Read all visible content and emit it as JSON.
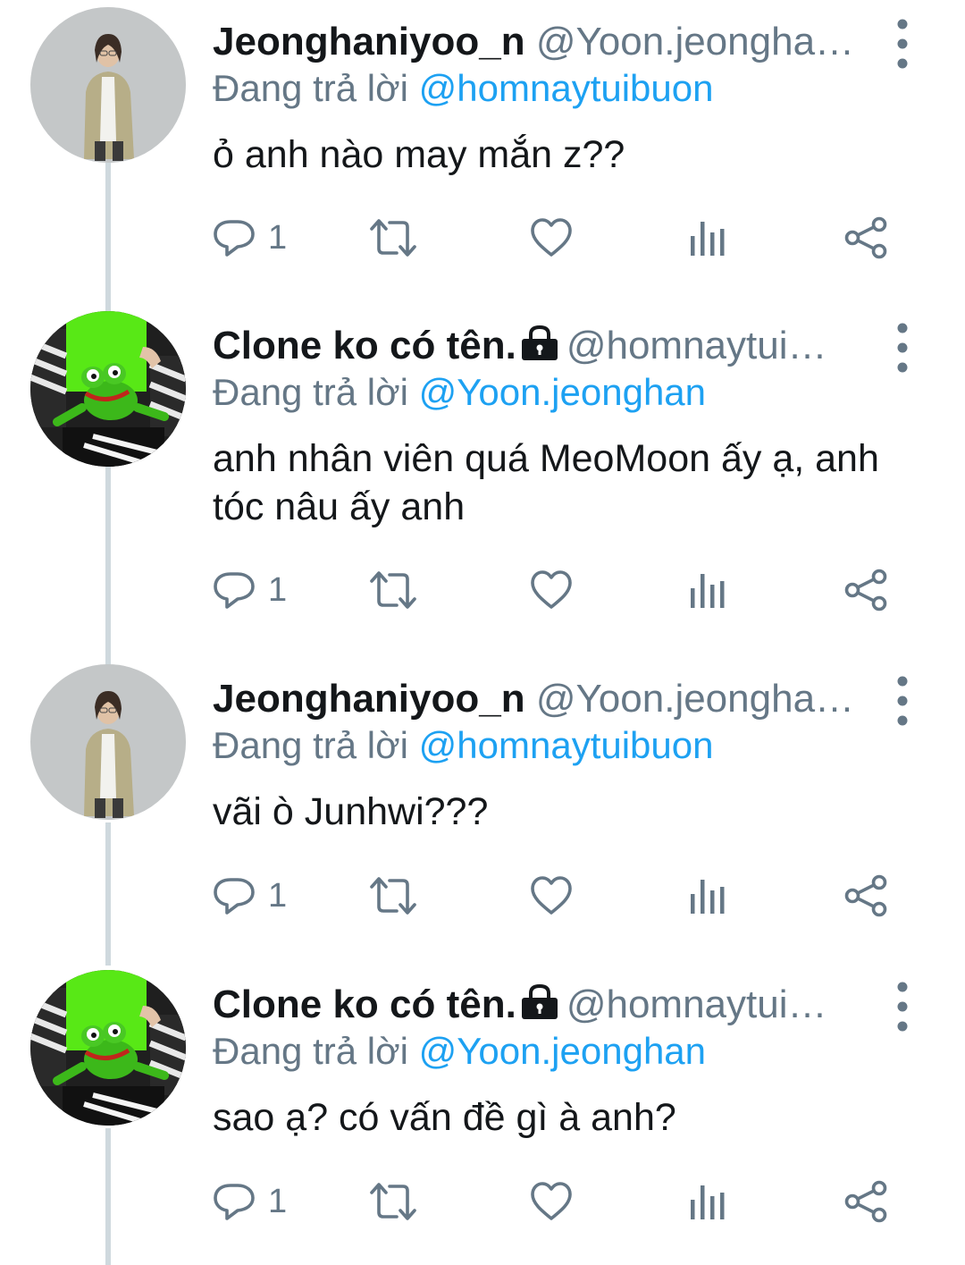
{
  "colors": {
    "accent": "#1da1f2",
    "secondary_text": "#657786",
    "thread_line": "#cfd9de"
  },
  "icons": {
    "more": "more-vertical-icon",
    "reply": "reply-icon",
    "retweet": "retweet-icon",
    "like": "heart-icon",
    "stats": "analytics-icon",
    "share": "share-icon",
    "lock": "lock-icon"
  },
  "tweets": [
    {
      "name": "Jeonghaniyoo_n",
      "handle": "@Yoon.jeongha…",
      "replying_prefix": "Đang trả lời ",
      "replying_to": "@homnaytuibuon",
      "text": "ỏ anh nào may mắn z??",
      "reply_count": "1"
    },
    {
      "name": "Clone ko có tên.",
      "handle": "@homnaytui…",
      "replying_prefix": "Đang trả lời ",
      "replying_to": "@Yoon.jeonghan",
      "text": "anh nhân viên quá MeoMoon ấy ạ, anh tóc nâu ấy anh",
      "reply_count": "1"
    },
    {
      "name": "Jeonghaniyoo_n",
      "handle": "@Yoon.jeongha…",
      "replying_prefix": "Đang trả lời ",
      "replying_to": "@homnaytuibuon",
      "text": "vãi ò Junhwi???",
      "reply_count": "1"
    },
    {
      "name": "Clone ko có tên.",
      "handle": "@homnaytui…",
      "replying_prefix": "Đang trả lời ",
      "replying_to": "@Yoon.jeonghan",
      "text": "sao ạ? có vấn đề gì à anh?",
      "reply_count": "1"
    }
  ]
}
